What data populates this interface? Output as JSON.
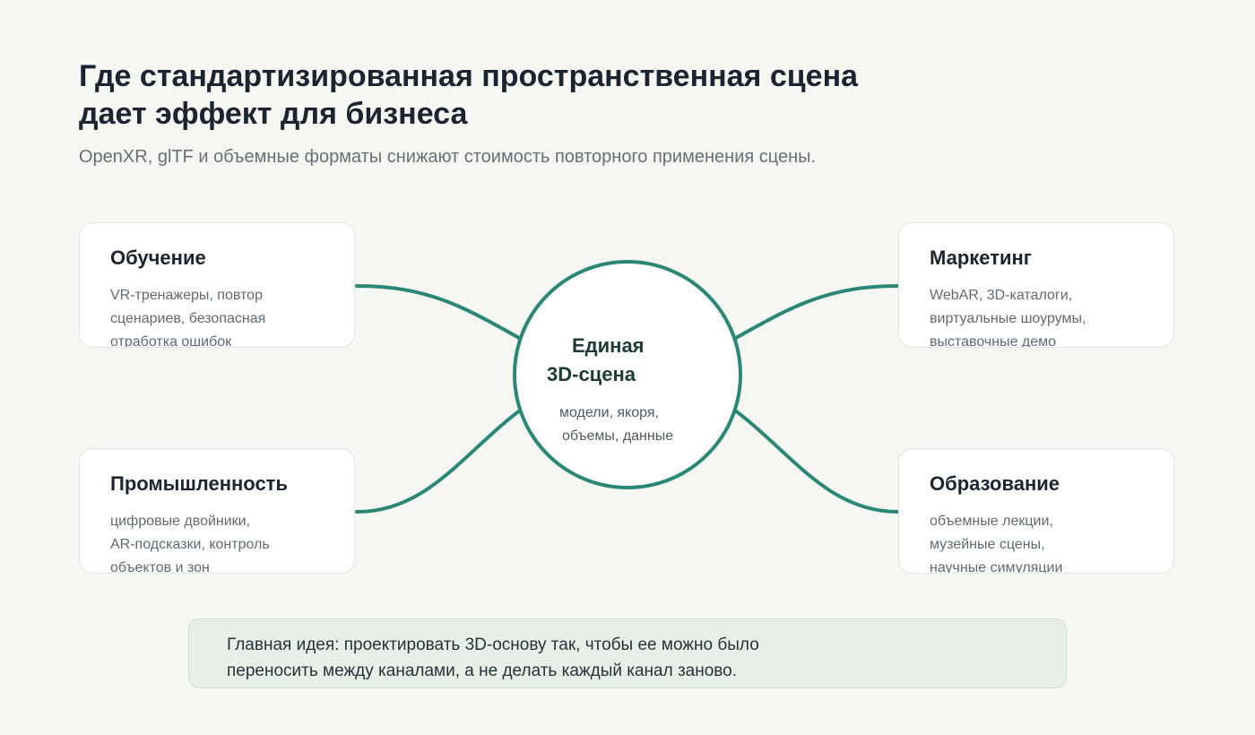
{
  "title_lines": [
    "Где стандартизированная пространственная сцена",
    "дает эффект для бизнеса"
  ],
  "subtitle": "OpenXR, glTF и объемные форматы снижают стоимость повторного применения сцены.",
  "hub": {
    "title_lines": [
      "Единая",
      "3D-сцена"
    ],
    "text_lines": [
      "модели, якоря,",
      "объемы, данные"
    ]
  },
  "cards": {
    "training": {
      "title": "Обучение",
      "lines": [
        "VR-тренажеры, повтор",
        "сценариев, безопасная",
        "отработка ошибок"
      ]
    },
    "industry": {
      "title": "Промышленность",
      "lines": [
        "цифровые двойники,",
        "AR-подсказки, контроль",
        "объектов и зон"
      ]
    },
    "marketing": {
      "title": "Маркетинг",
      "lines": [
        "WebAR, 3D-каталоги,",
        "виртуальные шоурумы,",
        "выставочные демо"
      ]
    },
    "education": {
      "title": "Образование",
      "lines": [
        "объемные лекции,",
        "музейные сцены,",
        "научные симуляции"
      ]
    }
  },
  "takeaway_lines": [
    "Главная идея: проектировать 3D-основу так, чтобы ее можно было",
    "переносить между каналами, а не делать каждый канал заново."
  ],
  "colors": {
    "accent": "#2a8775",
    "background": "#f6f7f3",
    "card": "#ffffff",
    "takeaway_bg": "#e7efe8"
  }
}
